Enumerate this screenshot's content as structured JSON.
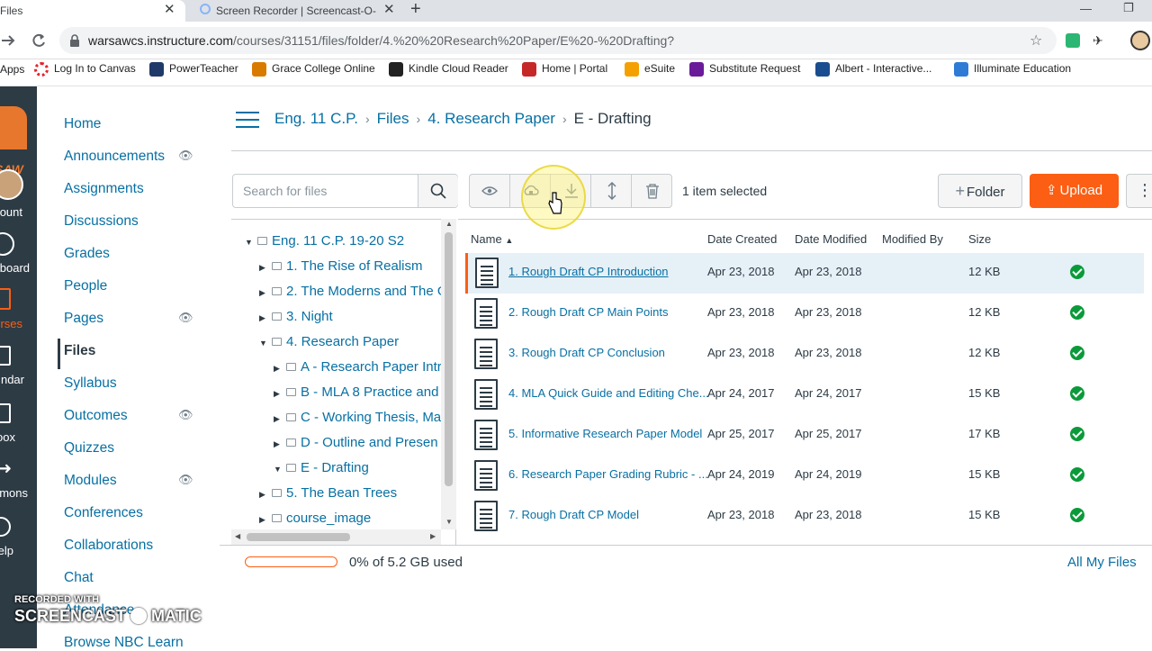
{
  "browser": {
    "tabs": [
      {
        "title": "Files"
      },
      {
        "title": "Screen Recorder | Screencast-O-M"
      }
    ],
    "url_host": "warsawcs.instructure.com",
    "url_path": "/courses/31151/files/folder/4.%20%20Research%20Paper/E%20-%20Drafting?",
    "bookmarks": [
      {
        "label": "Apps",
        "icon": "apps-icon",
        "color": "#4285f4"
      },
      {
        "label": "Log In to Canvas",
        "icon": "canvas-icon",
        "color": "#e72429"
      },
      {
        "label": "PowerTeacher",
        "icon": "powerteacher-icon",
        "color": "#1f3a68"
      },
      {
        "label": "Grace College Online",
        "icon": "grace-icon",
        "color": "#d97a00"
      },
      {
        "label": "Kindle Cloud Reader",
        "icon": "kindle-icon",
        "color": "#222222"
      },
      {
        "label": "Home | Portal",
        "icon": "portal-icon",
        "color": "#c62828"
      },
      {
        "label": "eSuite",
        "icon": "esuite-icon",
        "color": "#f4a100"
      },
      {
        "label": "Substitute Request",
        "icon": "substitute-icon",
        "color": "#6a1b9a"
      },
      {
        "label": "Albert - Interactive...",
        "icon": "albert-icon",
        "color": "#1a4d8f"
      },
      {
        "label": "Illuminate Education",
        "icon": "illuminate-icon",
        "color": "#2e7bd6"
      }
    ]
  },
  "global_nav": {
    "items": [
      {
        "label": "ount"
      },
      {
        "label": "board"
      },
      {
        "label": "rses"
      },
      {
        "label": "ndar"
      },
      {
        "label": "oox"
      },
      {
        "label": "mons"
      },
      {
        "label": "elp"
      }
    ],
    "brand_text": "SAW"
  },
  "course_nav": {
    "items": [
      {
        "label": "Home",
        "hidden": false
      },
      {
        "label": "Announcements",
        "hidden": true
      },
      {
        "label": "Assignments",
        "hidden": false
      },
      {
        "label": "Discussions",
        "hidden": false
      },
      {
        "label": "Grades",
        "hidden": false
      },
      {
        "label": "People",
        "hidden": false
      },
      {
        "label": "Pages",
        "hidden": true
      },
      {
        "label": "Files",
        "hidden": false,
        "active": true
      },
      {
        "label": "Syllabus",
        "hidden": false
      },
      {
        "label": "Outcomes",
        "hidden": true
      },
      {
        "label": "Quizzes",
        "hidden": false
      },
      {
        "label": "Modules",
        "hidden": true
      },
      {
        "label": "Conferences",
        "hidden": false
      },
      {
        "label": "Collaborations",
        "hidden": false
      },
      {
        "label": "Chat",
        "hidden": false
      },
      {
        "label": "Attendance",
        "hidden": false
      },
      {
        "label": "Browse NBC Learn",
        "hidden": false
      }
    ]
  },
  "breadcrumbs": [
    {
      "label": "Eng. 11 C.P."
    },
    {
      "label": "Files"
    },
    {
      "label": "4. Research Paper"
    },
    {
      "label": "E - Drafting"
    }
  ],
  "toolbar": {
    "search_placeholder": "Search for files",
    "selection_text": "1 item selected",
    "folder_label": "Folder",
    "upload_label": "Upload"
  },
  "tree": [
    {
      "label": "Eng. 11 C.P. 19-20 S2",
      "expanded": true
    },
    {
      "label": "1. The Rise of Realism",
      "expanded": false
    },
    {
      "label": "2. The Moderns and The G",
      "expanded": false
    },
    {
      "label": "3. Night",
      "expanded": false
    },
    {
      "label": "4. Research Paper",
      "expanded": true
    },
    {
      "label": "A - Research Paper Intro",
      "expanded": false
    },
    {
      "label": "B - MLA 8 Practice and E",
      "expanded": false
    },
    {
      "label": "C - Working Thesis, Ma",
      "expanded": false
    },
    {
      "label": "D - Outline and Presen",
      "expanded": false
    },
    {
      "label": "E - Drafting",
      "expanded": true
    },
    {
      "label": "5. The Bean Trees",
      "expanded": false
    },
    {
      "label": "course_image",
      "expanded": false
    }
  ],
  "table": {
    "columns": {
      "name": "Name",
      "created": "Date Created",
      "modified": "Date Modified",
      "modified_by": "Modified By",
      "size": "Size"
    },
    "rows": [
      {
        "name": "1. Rough Draft CP Introduction",
        "created": "Apr 23, 2018",
        "modified": "Apr 23, 2018",
        "modified_by": "",
        "size": "12 KB",
        "published": true,
        "selected": true
      },
      {
        "name": "2. Rough Draft CP Main Points",
        "created": "Apr 23, 2018",
        "modified": "Apr 23, 2018",
        "modified_by": "",
        "size": "12 KB",
        "published": true,
        "selected": false
      },
      {
        "name": "3. Rough Draft CP Conclusion",
        "created": "Apr 23, 2018",
        "modified": "Apr 23, 2018",
        "modified_by": "",
        "size": "12 KB",
        "published": true,
        "selected": false
      },
      {
        "name": "4. MLA Quick Guide and Editing Che...",
        "created": "Apr 24, 2017",
        "modified": "Apr 24, 2017",
        "modified_by": "",
        "size": "15 KB",
        "published": true,
        "selected": false
      },
      {
        "name": "5. Informative Research Paper Model",
        "created": "Apr 25, 2017",
        "modified": "Apr 25, 2017",
        "modified_by": "",
        "size": "17 KB",
        "published": true,
        "selected": false
      },
      {
        "name": "6. Research Paper Grading Rubric - ...",
        "created": "Apr 24, 2019",
        "modified": "Apr 24, 2019",
        "modified_by": "",
        "size": "15 KB",
        "published": true,
        "selected": false
      },
      {
        "name": "7. Rough Draft CP Model",
        "created": "Apr 23, 2018",
        "modified": "Apr 23, 2018",
        "modified_by": "",
        "size": "15 KB",
        "published": true,
        "selected": false
      }
    ]
  },
  "footer": {
    "quota_text": "0% of 5.2 GB used",
    "quota_percent": 0,
    "all_files_label": "All My Files"
  },
  "watermark": {
    "line1": "RECORDED WITH",
    "line2": "SCREENCAST",
    "line3": "MATIC"
  },
  "colors": {
    "link": "#0770a3",
    "accent": "#fc5e13",
    "nav_bg": "#2d3b45",
    "published": "#0b9a3a"
  }
}
